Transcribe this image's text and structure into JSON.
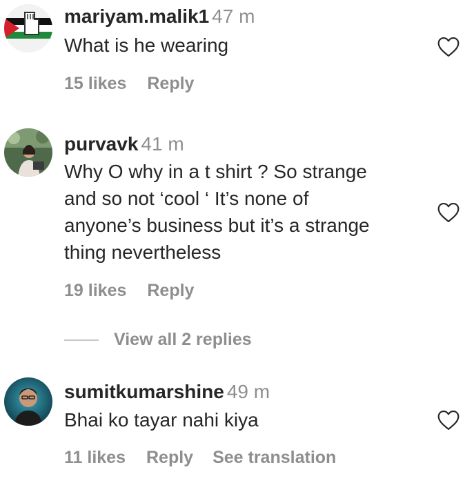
{
  "comments": [
    {
      "username": "mariyam.malik1",
      "time": "47 m",
      "lines": [
        "What is he wearing"
      ],
      "likes": "15 likes",
      "reply": "Reply",
      "avatar_icon": "palestine-flag-fist-icon"
    },
    {
      "username": "purvavk",
      "time": "41 m",
      "lines": [
        "Why O why in a t shirt ? So strange",
        "and so not ‘cool ‘ It’s none of",
        "anyone’s business but it’s a strange",
        "thing nevertheless"
      ],
      "likes": "19 likes",
      "reply": "Reply",
      "view_replies": "View all 2 replies",
      "avatar_icon": "person-photo-icon"
    },
    {
      "username": "sumitkumarshine",
      "time": "49 m",
      "lines": [
        "Bhai ko tayar nahi kiya"
      ],
      "likes": "11 likes",
      "reply": "Reply",
      "see_translation": "See translation",
      "avatar_icon": "person-photo-icon"
    }
  ],
  "colors": {
    "text_primary": "#262626",
    "text_secondary": "#8e8e8e",
    "divider": "#c7c7c7"
  },
  "icons": {
    "like": "heart-outline-icon"
  }
}
